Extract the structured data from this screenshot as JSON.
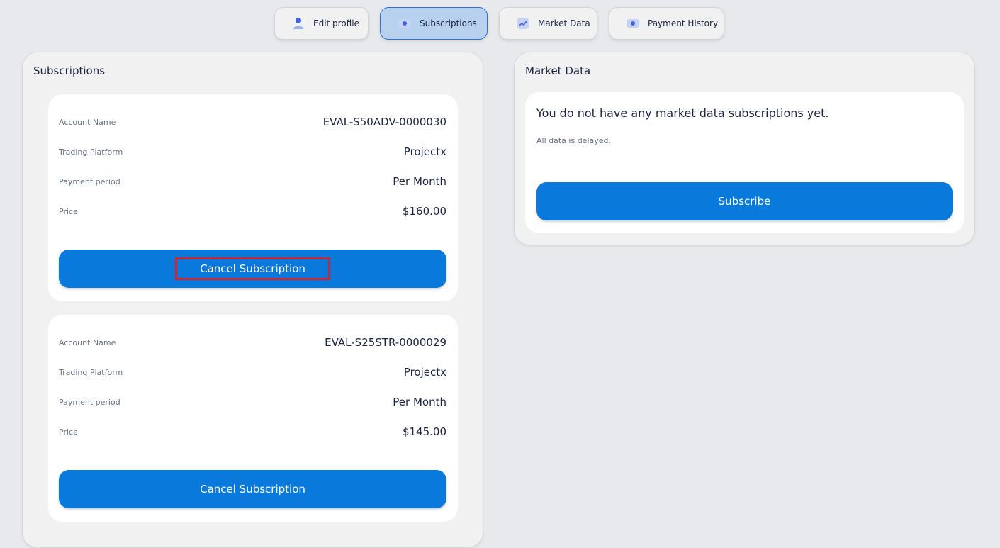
{
  "tabs": [
    {
      "label": "Edit profile",
      "icon": "user-icon",
      "active": false
    },
    {
      "label": "Subscriptions",
      "icon": "ticket-icon",
      "active": true
    },
    {
      "label": "Market Data",
      "icon": "chart-line-icon",
      "active": false
    },
    {
      "label": "Payment History",
      "icon": "ticket-icon",
      "active": false
    }
  ],
  "subscriptions": {
    "title": "Subscriptions",
    "cards": [
      {
        "rows": [
          {
            "label": "Account Name",
            "value": "EVAL-S50ADV-0000030"
          },
          {
            "label": "Trading Platform",
            "value": "Projectx"
          },
          {
            "label": "Payment period",
            "value": "Per Month"
          },
          {
            "label": "Price",
            "value": "$160.00"
          }
        ],
        "button": "Cancel Subscription"
      },
      {
        "rows": [
          {
            "label": "Account Name",
            "value": "EVAL-S25STR-0000029"
          },
          {
            "label": "Trading Platform",
            "value": "Projectx"
          },
          {
            "label": "Payment period",
            "value": "Per Month"
          },
          {
            "label": "Price",
            "value": "$145.00"
          }
        ],
        "button": "Cancel Subscription"
      }
    ]
  },
  "market": {
    "title": "Market Data",
    "message": "You do not have any market data subscriptions yet.",
    "note": "All data is delayed.",
    "button": "Subscribe"
  },
  "colors": {
    "accent": "#0a79dc",
    "active_tab": "#b8d1ef",
    "highlight": "#d2232a",
    "background": "#e8e9ec"
  }
}
